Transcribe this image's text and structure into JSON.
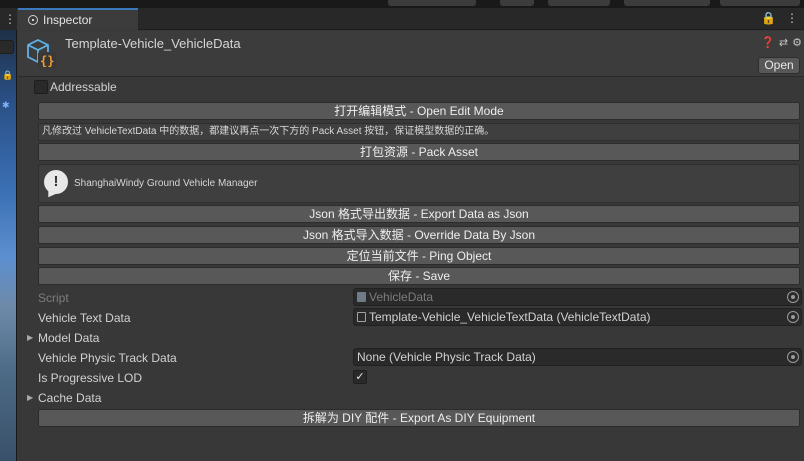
{
  "tab": {
    "label": "Inspector"
  },
  "header": {
    "title": "Template-Vehicle_VehicleData",
    "open_label": "Open",
    "icons": [
      "help-icon",
      "preset-icon",
      "settings-icon"
    ]
  },
  "addressable": {
    "label": "Addressable",
    "checked": false
  },
  "buttons": {
    "open_edit": "打开编辑模式 - Open Edit Mode",
    "pack_asset": "打包资源 - Pack Asset",
    "export_json": "Json 格式导出数据 - Export Data as Json",
    "override_json": "Json 格式导入数据 - Override Data By Json",
    "ping_object": "定位当前文件 - Ping Object",
    "save": "保存 - Save",
    "export_diy": "拆解为 DIY 配件 - Export As DIY Equipment"
  },
  "note": "凡修改过 VehicleTextData 中的数据，都建议再点一次下方的 Pack Asset 按钮，保证模型数据的正确。",
  "help": {
    "text": "ShanghaiWindy Ground Vehicle Manager"
  },
  "properties": {
    "script": {
      "label": "Script",
      "value": "VehicleData"
    },
    "vehicle_text_data": {
      "label": "Vehicle Text Data",
      "value": "Template-Vehicle_VehicleTextData (VehicleTextData)"
    },
    "model_data": {
      "label": "Model Data"
    },
    "vehicle_physic_track": {
      "label": "Vehicle Physic Track Data",
      "value": "None (Vehicle Physic Track Data)"
    },
    "is_progressive_lod": {
      "label": "Is Progressive LOD",
      "checked": true
    },
    "cache_data": {
      "label": "Cache Data"
    }
  },
  "colors": {
    "panel": "#383838",
    "button": "#585858",
    "field": "#2a2a2a",
    "tab_accent": "#3a79bb"
  }
}
